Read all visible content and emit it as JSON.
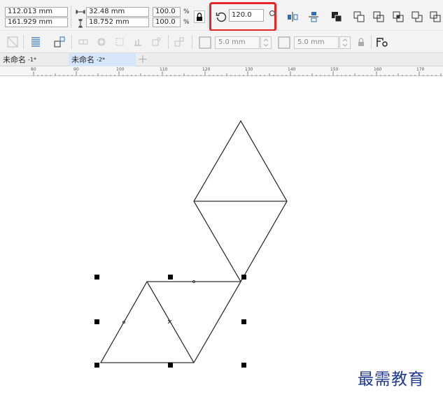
{
  "property_bar": {
    "x_position": "112.013 mm",
    "y_position": "161.929 mm",
    "width": "32.48 mm",
    "height": "18.752 mm",
    "scale_x": "100.0",
    "scale_y": "100.0",
    "scale_unit": "%",
    "rotation_angle": "120.0"
  },
  "toolbar2": {
    "outline_width_1": "5.0 mm",
    "outline_width_2": "5.0 mm"
  },
  "tabs": [
    {
      "label": "未命名",
      "suffix": "-1*"
    },
    {
      "label": "未命名",
      "suffix": "-2*"
    }
  ],
  "ruler": {
    "ticks": [
      "80",
      "90",
      "100",
      "110",
      "120",
      "130",
      "140",
      "150",
      "160",
      "170"
    ]
  },
  "watermark": "最需教育",
  "colors": {
    "highlight": "#e3262a",
    "active_tab": "#d6e5f7",
    "watermark": "#1f3a8f"
  }
}
